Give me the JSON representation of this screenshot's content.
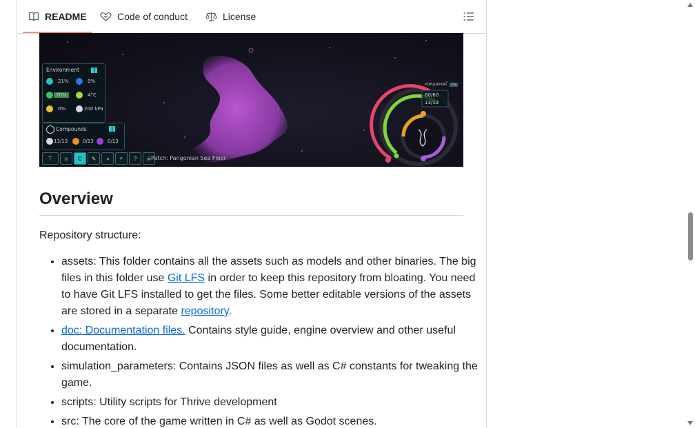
{
  "tabs": [
    {
      "label": "README",
      "icon": "book-icon",
      "active": true
    },
    {
      "label": "Code of conduct",
      "icon": "heart-handshake-icon",
      "active": false
    },
    {
      "label": "License",
      "icon": "scale-icon",
      "active": false
    }
  ],
  "toc_icon": "list-icon",
  "game_hud": {
    "environment_title": "Environment",
    "env_stats": [
      "21%",
      "9%",
      "70%",
      "4°C",
      "0%",
      "200 kPa"
    ],
    "compounds_title": "Compounds",
    "compounds": [
      "13/13",
      "0/13",
      "0/13"
    ],
    "population_label": "POPULATION",
    "population_badge": "1%",
    "population_values": [
      "60/60",
      "13/13"
    ],
    "toolbar_active": "C",
    "patch_label": "Patch: Pangonian Sea Floor"
  },
  "overview": {
    "heading": "Overview",
    "intro": "Repository structure:",
    "items": [
      {
        "t1": "assets: This folder contains all the assets such as models and other binaries. The big files in this folder use ",
        "link1": "Git LFS",
        "t2": " in order to keep this repository from bloating. You need to have Git LFS installed to get the files. Some better editable versions of the assets are stored in a separate ",
        "link2": "repository",
        "t3": "."
      },
      {
        "link1": "doc: Documentation files.",
        "t2": " Contains style guide, engine overview and other useful documentation."
      },
      {
        "t1": "simulation_parameters: Contains JSON files as well as C# constants for tweaking the game."
      },
      {
        "t1": "scripts: Utility scripts for Thrive development"
      },
      {
        "t1": "src: The core of the game written in C# as well as Godot scenes."
      }
    ]
  },
  "colors": {
    "tab_underline": "#fd8c73",
    "link": "#0969da",
    "hud_accent": "#1ac6c8"
  }
}
